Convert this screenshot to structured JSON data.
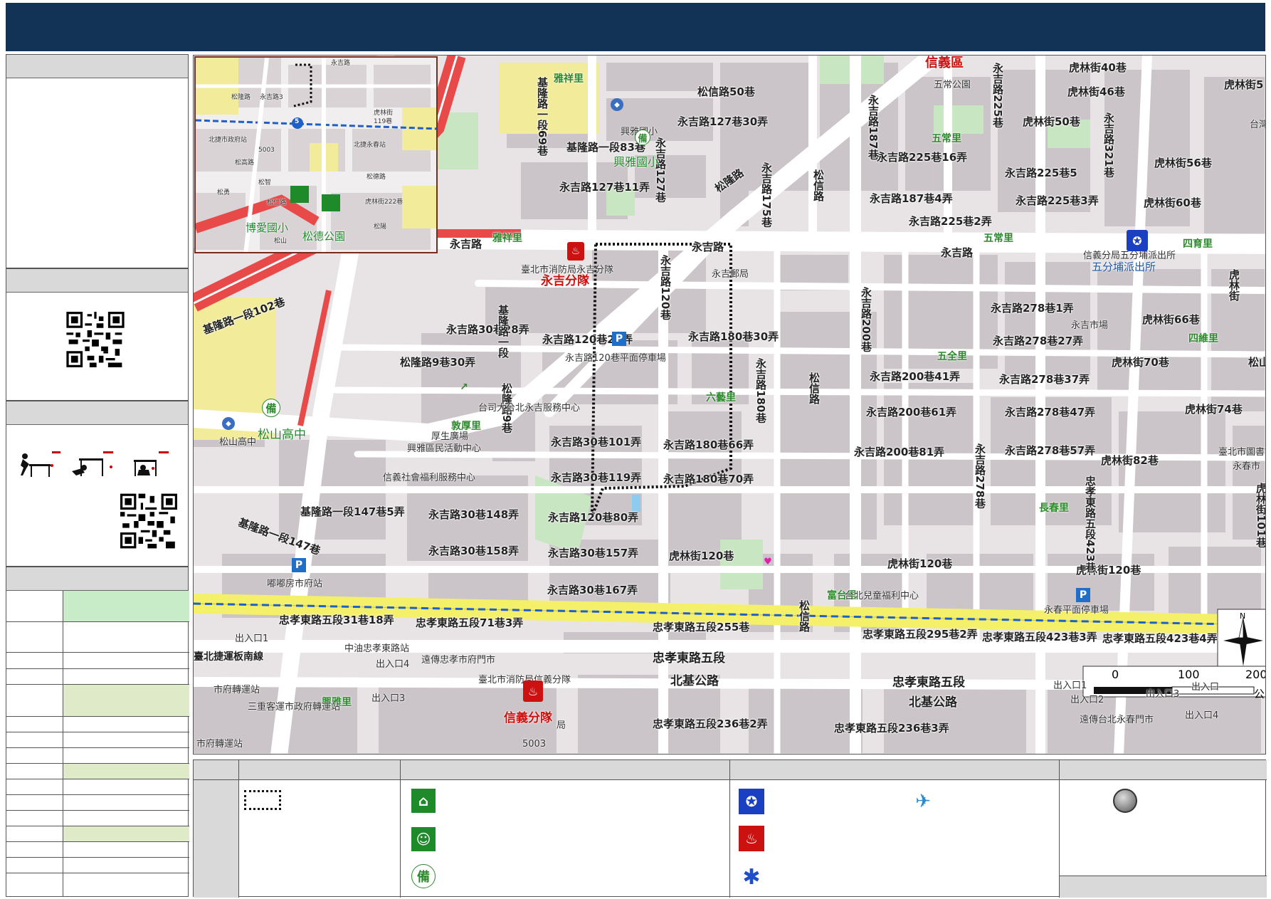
{
  "map": {
    "streets": [
      {
        "id": "yongji-rd",
        "text": "永吉路"
      },
      {
        "id": "yongji-rd-2",
        "text": "永吉路"
      },
      {
        "id": "yongji-rd-3",
        "text": "永吉路"
      },
      {
        "id": "songxin-50",
        "text": "松信路50巷"
      },
      {
        "id": "yongji-127-30",
        "text": "永吉路127巷30弄"
      },
      {
        "id": "jilong-83",
        "text": "基隆路一段83巷"
      },
      {
        "id": "yongji-127-11",
        "text": "永吉路127巷11弄"
      },
      {
        "id": "songlong-rd",
        "text": "松隆路"
      },
      {
        "id": "yongji-175",
        "text": "永吉路175巷"
      },
      {
        "id": "songxin-rd",
        "text": "松信路"
      },
      {
        "id": "yongji-225-16",
        "text": "永吉路225巷16弄"
      },
      {
        "id": "yongji-225-5",
        "text": "永吉路225巷5"
      },
      {
        "id": "yongji-187-4",
        "text": "永吉路187巷4弄"
      },
      {
        "id": "yongji-225-3",
        "text": "永吉路225巷3弄"
      },
      {
        "id": "yongji-225-2",
        "text": "永吉路225巷2弄"
      },
      {
        "id": "hulin-40",
        "text": "虎林街40巷"
      },
      {
        "id": "hulin-46",
        "text": "虎林街46巷"
      },
      {
        "id": "hulin-50",
        "text": "虎林街50巷"
      },
      {
        "id": "hulin-56",
        "text": "虎林街56巷"
      },
      {
        "id": "hulin-60",
        "text": "虎林街60巷"
      },
      {
        "id": "hulin-5",
        "text": "虎林街5"
      },
      {
        "id": "jilong-102",
        "text": "基隆路一段102巷"
      },
      {
        "id": "yongji-30-28",
        "text": "永吉路30巷28弄"
      },
      {
        "id": "yongji-120-22",
        "text": "永吉路120巷22弄"
      },
      {
        "id": "yongji-180-30",
        "text": "永吉路180巷30弄"
      },
      {
        "id": "songlong-9-30",
        "text": "松隆路9巷30弄"
      },
      {
        "id": "yongji-200-41",
        "text": "永吉路200巷41弄"
      },
      {
        "id": "yongji-278-1",
        "text": "永吉路278巷1弄"
      },
      {
        "id": "yongji-278-27",
        "text": "永吉路278巷27弄"
      },
      {
        "id": "yongji-278-37",
        "text": "永吉路278巷37弄"
      },
      {
        "id": "yongji-278-47",
        "text": "永吉路278巷47弄"
      },
      {
        "id": "yongji-278-57",
        "text": "永吉路278巷57弄"
      },
      {
        "id": "yongji-200-61",
        "text": "永吉路200巷61弄"
      },
      {
        "id": "yongji-200-81",
        "text": "永吉路200巷81弄"
      },
      {
        "id": "hulin-66",
        "text": "虎林街66巷"
      },
      {
        "id": "hulin-70",
        "text": "虎林街70巷"
      },
      {
        "id": "hulin-74",
        "text": "虎林街74巷"
      },
      {
        "id": "hulin-82",
        "text": "虎林街82巷"
      },
      {
        "id": "yongji-30-101",
        "text": "永吉路30巷101弄"
      },
      {
        "id": "yongji-180-66",
        "text": "永吉路180巷66弄"
      },
      {
        "id": "yongji-30-119",
        "text": "永吉路30巷119弄"
      },
      {
        "id": "yongji-180-70",
        "text": "永吉路180巷70弄"
      },
      {
        "id": "jilong-147-5",
        "text": "基隆路一段147巷5弄"
      },
      {
        "id": "yongji-30-148",
        "text": "永吉路30巷148弄"
      },
      {
        "id": "yongji-120-80",
        "text": "永吉路120巷80弄"
      },
      {
        "id": "jilong-147",
        "text": "基隆路一段147巷"
      },
      {
        "id": "yongji-30-158",
        "text": "永吉路30巷158弄"
      },
      {
        "id": "yongji-30-157",
        "text": "永吉路30巷157弄"
      },
      {
        "id": "hulin-120-a",
        "text": "虎林街120巷"
      },
      {
        "id": "hulin-120-b",
        "text": "虎林街120巷"
      },
      {
        "id": "hulin-120-c",
        "text": "虎林街120巷"
      },
      {
        "id": "yongji-30-167",
        "text": "永吉路30巷167弄"
      },
      {
        "id": "zhongxiao-31-18",
        "text": "忠孝東路五段31巷18弄"
      },
      {
        "id": "zhongxiao-71-3",
        "text": "忠孝東路五段71巷3弄"
      },
      {
        "id": "zhongxiao-255",
        "text": "忠孝東路五段255巷"
      },
      {
        "id": "zhongxiao-295-2",
        "text": "忠孝東路五段295巷2弄"
      },
      {
        "id": "zhongxiao-423-3",
        "text": "忠孝東路五段423巷3弄"
      },
      {
        "id": "zhongxiao-423-4",
        "text": "忠孝東路五段423巷4弄"
      },
      {
        "id": "zhongxiao-5",
        "text": "忠孝東路五段"
      },
      {
        "id": "zhongxiao-5-b",
        "text": "忠孝東路五段"
      },
      {
        "id": "beiji-rd",
        "text": "北基公路"
      },
      {
        "id": "beiji-rd-b",
        "text": "北基公路"
      },
      {
        "id": "zhongxiao-236-2",
        "text": "忠孝東路五段236巷2弄"
      },
      {
        "id": "zhongxiao-236-3",
        "text": "忠孝東路五段236巷3弄"
      },
      {
        "id": "bannan-line",
        "text": "臺北捷運板南線"
      }
    ],
    "vertical_streets": [
      {
        "id": "jilong-1-69",
        "text": "基隆路一段69巷"
      },
      {
        "id": "yongji-127",
        "text": "永吉路127巷"
      },
      {
        "id": "yongji-175-v",
        "text": "永吉路175巷"
      },
      {
        "id": "songxin-v",
        "text": "松信路"
      },
      {
        "id": "yongji-187",
        "text": "永吉路187巷"
      },
      {
        "id": "yongji-225",
        "text": "永吉路225巷"
      },
      {
        "id": "yongji-321",
        "text": "永吉路321巷"
      },
      {
        "id": "yongji-120",
        "text": "永吉路120巷"
      },
      {
        "id": "yongji-180",
        "text": "永吉路180巷"
      },
      {
        "id": "songxin-v2",
        "text": "松信路"
      },
      {
        "id": "yongji-200",
        "text": "永吉路200巷"
      },
      {
        "id": "yongji-278",
        "text": "永吉路278巷"
      },
      {
        "id": "zhongxiao-423",
        "text": "忠孝東路五段423巷"
      },
      {
        "id": "songxin-v3",
        "text": "松信路"
      },
      {
        "id": "jilong-1-v",
        "text": "基隆路一段"
      },
      {
        "id": "songlong-9",
        "text": "松隆路9巷"
      },
      {
        "id": "hulin-v",
        "text": "虎林街"
      },
      {
        "id": "hulin-101",
        "text": "虎林街101巷"
      },
      {
        "id": "songshan-rd",
        "text": "松山路"
      }
    ],
    "villages": [
      {
        "id": "yaxiang",
        "text": "雅祥里"
      },
      {
        "id": "yaxiang-2",
        "text": "雅祥里"
      },
      {
        "id": "wuchang",
        "text": "五常里"
      },
      {
        "id": "wuchang-2",
        "text": "五常里"
      },
      {
        "id": "sichang",
        "text": "四育里"
      },
      {
        "id": "liuyi",
        "text": "六藝里"
      },
      {
        "id": "wuquan",
        "text": "五全里"
      },
      {
        "id": "siwei",
        "text": "四維里"
      },
      {
        "id": "jiaohou",
        "text": "敦厚里"
      },
      {
        "id": "changchun",
        "text": "長春里"
      },
      {
        "id": "futai",
        "text": "富台里"
      },
      {
        "id": "yuya",
        "text": "興雅里"
      }
    ],
    "places": [
      {
        "id": "wuchang-park",
        "text": "五常公園"
      },
      {
        "id": "xingya-elem",
        "text": "興雅國小"
      },
      {
        "id": "xingya-elem-2",
        "text": "興雅國小"
      },
      {
        "id": "yongji-post",
        "text": "永吉郵局"
      },
      {
        "id": "fire-yongji-full",
        "text": "臺北市消防局永吉分隊"
      },
      {
        "id": "yongji-parking",
        "text": "永吉路120巷平面停車場"
      },
      {
        "id": "taipower",
        "text": "台司大台北永吉服務中心"
      },
      {
        "id": "housheng",
        "text": "厚生廣場"
      },
      {
        "id": "xingya-center",
        "text": "興雅區民活動中心"
      },
      {
        "id": "xinyi-social",
        "text": "信義社會福利服務中心"
      },
      {
        "id": "songshan-high",
        "text": "松山高中"
      },
      {
        "id": "songshan-high-2",
        "text": "松山高中"
      },
      {
        "id": "yongji-market",
        "text": "永吉市場"
      },
      {
        "id": "police-full",
        "text": "信義分局五分埔派出所"
      },
      {
        "id": "library",
        "text": "臺北市圖書館永"
      },
      {
        "id": "yongchun-st",
        "text": "永春市"
      },
      {
        "id": "child-welfare",
        "text": "台北兒童福利中心"
      },
      {
        "id": "yongchun-parking",
        "text": "永春平面停車場"
      },
      {
        "id": "tiantai-parking",
        "text": "嘟嘟房市府站"
      },
      {
        "id": "zhongyou",
        "text": "中油忠孝東路站"
      },
      {
        "id": "fareast",
        "text": "遠傳忠孝市府門市"
      },
      {
        "id": "fire-xinyi-full",
        "text": "臺北市消防局信義分隊"
      },
      {
        "id": "sanchong",
        "text": "三重客運市政府轉運站"
      },
      {
        "id": "shifu-station",
        "text": "市府轉運站"
      },
      {
        "id": "shifu-station-2",
        "text": "市府轉運站"
      },
      {
        "id": "fareast-2",
        "text": "遠傳台北永春門市"
      },
      {
        "id": "xinyi-district",
        "text": "信義區"
      },
      {
        "id": "ya-elem",
        "text": "興雅國小"
      },
      {
        "id": "code-5003",
        "text": "5003"
      },
      {
        "id": "ju",
        "text": "局"
      },
      {
        "id": "taipei-post",
        "text": "台灣"
      }
    ],
    "exits": [
      {
        "id": "exit1",
        "text": "出入口1"
      },
      {
        "id": "exit4",
        "text": "出入口4"
      },
      {
        "id": "exit3",
        "text": "出入口3"
      },
      {
        "id": "exit1b",
        "text": "出入口1"
      },
      {
        "id": "exit2",
        "text": "出入口2"
      },
      {
        "id": "exit3b",
        "text": "出入口3"
      },
      {
        "id": "exit4b",
        "text": "出入口4"
      },
      {
        "id": "exit-r",
        "text": "出入口"
      }
    ],
    "red_labels": {
      "yongji_squad": "永吉分隊",
      "xinyi_squad": "信義分隊"
    },
    "blue_labels": {
      "police": "五分埔派出所"
    },
    "reserve_char": "備",
    "scale": {
      "ticks": [
        "0",
        "100",
        "200"
      ],
      "unit": "公尺"
    },
    "north": "N"
  },
  "inset": {
    "streets": [
      {
        "id": "i-yongji",
        "text": "永吉路"
      },
      {
        "id": "i-songlong",
        "text": "松隆路"
      },
      {
        "id": "i-yongji3",
        "text": "永吉路3"
      },
      {
        "id": "i-hulin",
        "text": "虎林街"
      },
      {
        "id": "i-hulin119",
        "text": "119巷"
      },
      {
        "id": "i-songgao",
        "text": "松高路"
      },
      {
        "id": "i-songren",
        "text": "松仁路"
      },
      {
        "id": "i-songzhi",
        "text": "松智"
      },
      {
        "id": "i-songyong",
        "text": "松勇"
      },
      {
        "id": "i-songde",
        "text": "松德路"
      },
      {
        "id": "i-songshan",
        "text": "松山"
      },
      {
        "id": "i-hulin222",
        "text": "虎林街222巷"
      },
      {
        "id": "i-songyang",
        "text": "松陽"
      }
    ],
    "places": [
      {
        "id": "i-shifu",
        "text": "北捷市政府站"
      },
      {
        "id": "i-yongchun",
        "text": "北捷永春站"
      },
      {
        "id": "i-5003",
        "text": "5003"
      },
      {
        "id": "i-boai",
        "text": "博愛國小"
      },
      {
        "id": "i-songde-park",
        "text": "松德公園"
      }
    ],
    "metro_badge": "5"
  },
  "legend_colors": {
    "header": "#133356",
    "panel_gray": "#d9d9d9",
    "fill_green": "#c8ecc8",
    "fill_olive": "#dfeac8",
    "road_yellow": "#f5f06a",
    "road_red": "#e84a4a",
    "metro_blue": "#1f5fc8"
  }
}
